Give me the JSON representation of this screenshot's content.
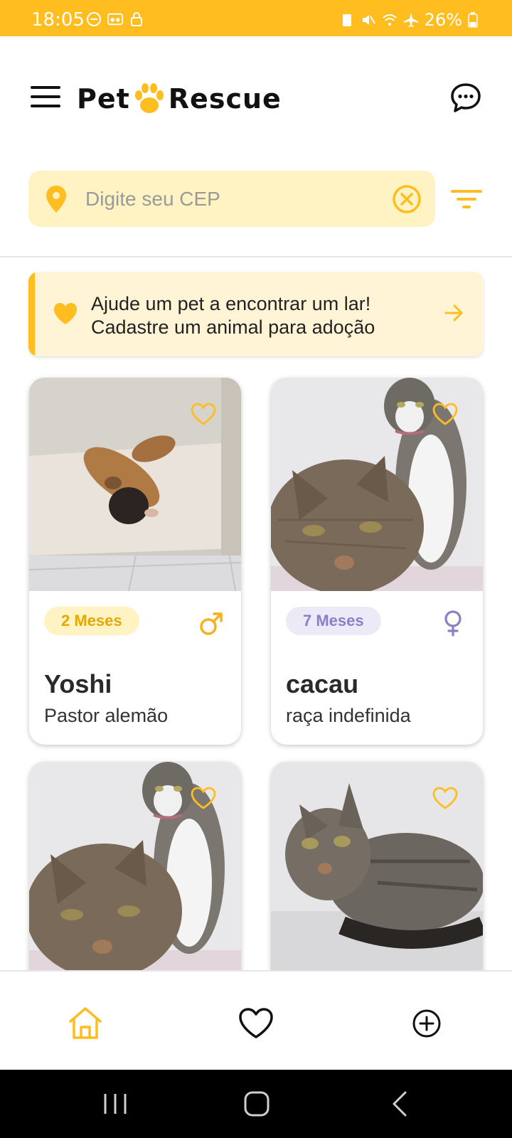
{
  "status_bar": {
    "time": "18:05",
    "battery": "26%",
    "bg_color": "#FFBD1F",
    "left_icons": [
      "dnd-icon",
      "voicemail-icon",
      "lock-icon"
    ],
    "right_icons": [
      "battery-saver-icon",
      "mute-icon",
      "wifi-icon",
      "airplane-icon",
      "battery-icon"
    ]
  },
  "header": {
    "logo_left": "Pet",
    "logo_right": "Rescue",
    "menu_icon": "hamburger-menu-icon",
    "chat_icon": "chat-bubble-icon"
  },
  "search": {
    "placeholder": "Digite seu CEP",
    "value": "",
    "pin_icon": "location-pin-icon",
    "clear_icon": "clear-circle-icon",
    "filter_icon": "filter-icon"
  },
  "banner": {
    "line1": "Ajude um pet a encontrar um lar!",
    "line2": "Cadastre um animal para adoção",
    "icon": "heart-icon",
    "arrow_icon": "arrow-right-icon"
  },
  "pets": [
    {
      "name": "Yoshi",
      "breed": "Pastor alemão",
      "age": "2 Meses",
      "sex": "male",
      "age_style": "yellow"
    },
    {
      "name": "cacau",
      "breed": "raça indefinida",
      "age": "7 Meses",
      "sex": "female",
      "age_style": "purple"
    },
    {
      "name": "",
      "breed": "",
      "age": "",
      "sex": "",
      "age_style": ""
    },
    {
      "name": "",
      "breed": "",
      "age": "",
      "sex": "",
      "age_style": ""
    }
  ],
  "bottom_nav": {
    "items": [
      {
        "icon": "home-icon",
        "active": true
      },
      {
        "icon": "favorites-heart-icon",
        "active": false
      },
      {
        "icon": "add-circle-icon",
        "active": false
      }
    ]
  },
  "colors": {
    "accent": "#FFBD1F",
    "accent_light": "#FFF3C4",
    "female": "#8C7FC4",
    "male": "#F5B21B"
  }
}
